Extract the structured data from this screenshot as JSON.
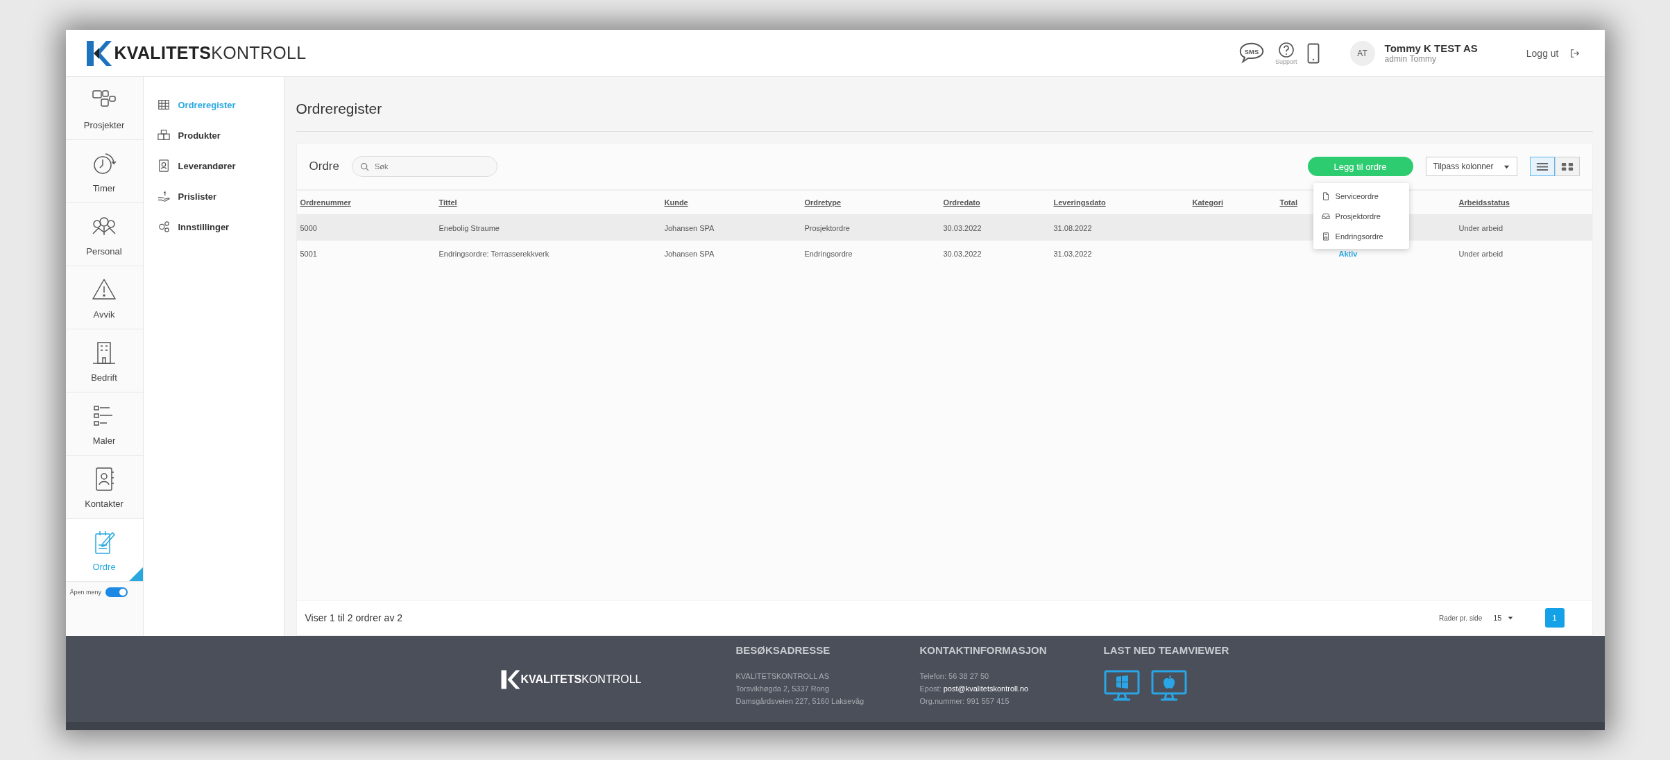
{
  "header": {
    "logo": {
      "bold": "KVALITETS",
      "light": "KONTROLL"
    },
    "sms_label": "SMS",
    "support_label": "Support",
    "avatar_initials": "AT",
    "company": "Tommy K TEST AS",
    "user": "admin Tommy",
    "logout": "Logg ut"
  },
  "sidebar": {
    "items": [
      {
        "label": "Prosjekter",
        "kind": "projects",
        "selected": false
      },
      {
        "label": "Timer",
        "kind": "clock",
        "selected": false
      },
      {
        "label": "Personal",
        "kind": "people",
        "selected": false
      },
      {
        "label": "Avvik",
        "kind": "warning",
        "selected": false
      },
      {
        "label": "Bedrift",
        "kind": "building",
        "selected": false
      },
      {
        "label": "Maler",
        "kind": "list",
        "selected": false
      },
      {
        "label": "Kontakter",
        "kind": "contacts",
        "selected": false
      },
      {
        "label": "Ordre",
        "kind": "order",
        "selected": true
      }
    ],
    "toggle": {
      "label": "Åpen meny",
      "on": true
    }
  },
  "subnav": {
    "items": [
      {
        "label": "Ordreregister",
        "kind": "table",
        "selected": true
      },
      {
        "label": "Produkter",
        "kind": "boxes",
        "selected": false
      },
      {
        "label": "Leverandører",
        "kind": "badge",
        "selected": false
      },
      {
        "label": "Prislister",
        "kind": "hand",
        "selected": false
      },
      {
        "label": "Innstillinger",
        "kind": "gears",
        "selected": false
      }
    ]
  },
  "page_title": "Ordreregister",
  "card": {
    "title": "Ordre",
    "search": {
      "placeholder": "Søk"
    },
    "add_button": "Legg til ordre",
    "columns_button": "Tilpass kolonner",
    "view_toggles": [
      {
        "kind": "list",
        "selected": true
      },
      {
        "kind": "split",
        "selected": false
      }
    ],
    "dropdown": [
      {
        "label": "Serviceordre",
        "kind": "file"
      },
      {
        "label": "Prosjektordre",
        "kind": "tray"
      },
      {
        "label": "Endringsordre",
        "kind": "doc"
      }
    ],
    "table": {
      "columns": [
        "Ordrenummer",
        "Tittel",
        "Kunde",
        "Ordretype",
        "Ordredato",
        "Leveringsdato",
        "Kategori",
        "Total",
        "Arbeidsstatus"
      ],
      "rows": [
        {
          "selected": true,
          "ordrenummer": "5000",
          "tittel": "Enebolig Straume",
          "kunde": "Johansen SPA",
          "ordretype": "Prosjektordre",
          "ordredato": "30.03.2022",
          "leveringsdato": "31.08.2022",
          "arbeidsstatus": "Under arbeid"
        },
        {
          "selected": false,
          "ordrenummer": "5001",
          "tittel": "Endringsordre: Terrasserekkverk",
          "kunde": "Johansen SPA",
          "ordretype": "Endringsordre",
          "ordredato": "30.03.2022",
          "leveringsdato": "31.03.2022",
          "column_9": "Aktiv",
          "arbeidsstatus": "Under arbeid"
        }
      ]
    },
    "footer_text": "Viser 1 til 2 ordrer av 2",
    "rows_per_page_label": "Rader pr. side",
    "rows_per_page": "15",
    "pages": [
      {
        "label": "1",
        "selected": true
      }
    ]
  },
  "footer": {
    "logo": {
      "bold": "KVALITETS",
      "light": "KONTROLL"
    },
    "address": {
      "heading": "BESØKSADRESSE",
      "lines": [
        "KVALITETSKONTROLL AS",
        "Torsvikhøgda 2, 5337 Rong",
        "Damsgårdsveien 227, 5160 Laksevåg"
      ]
    },
    "contact": {
      "heading": "KONTAKTINFORMASJON",
      "phone": "Telefon: 56 38 27 50",
      "email_label": "Epost:",
      "email": "post@kvalitetskontroll.no",
      "org": "Org.nummer: 991 557 415"
    },
    "download": {
      "heading": "LAST NED TEAMVIEWER",
      "items": [
        {
          "kind": "windows"
        },
        {
          "kind": "apple"
        }
      ]
    }
  }
}
